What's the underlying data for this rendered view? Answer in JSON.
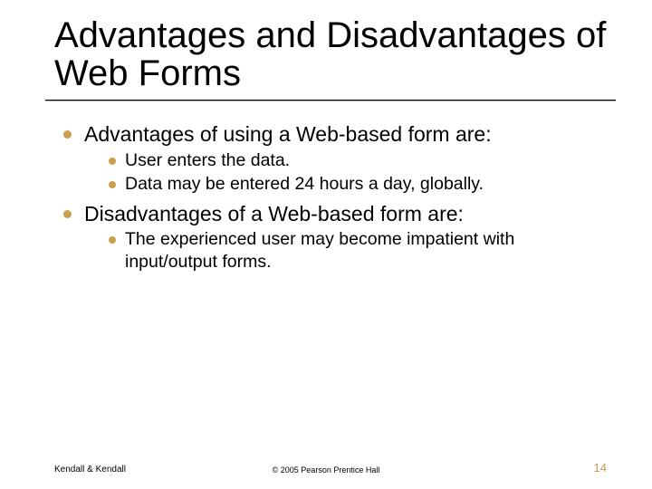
{
  "title": "Advantages and Disadvantages of Web Forms",
  "bullets": {
    "l1_0": "Advantages of using a Web-based form are:",
    "l2_0": "User enters the data.",
    "l2_1": "Data may be entered 24 hours a day, globally.",
    "l1_1": "Disadvantages of a Web-based form are:",
    "l2_2": "The experienced user may become impatient with input/output forms."
  },
  "footer": {
    "left": "Kendall & Kendall",
    "center": "© 2005 Pearson Prentice Hall",
    "right": "14"
  }
}
